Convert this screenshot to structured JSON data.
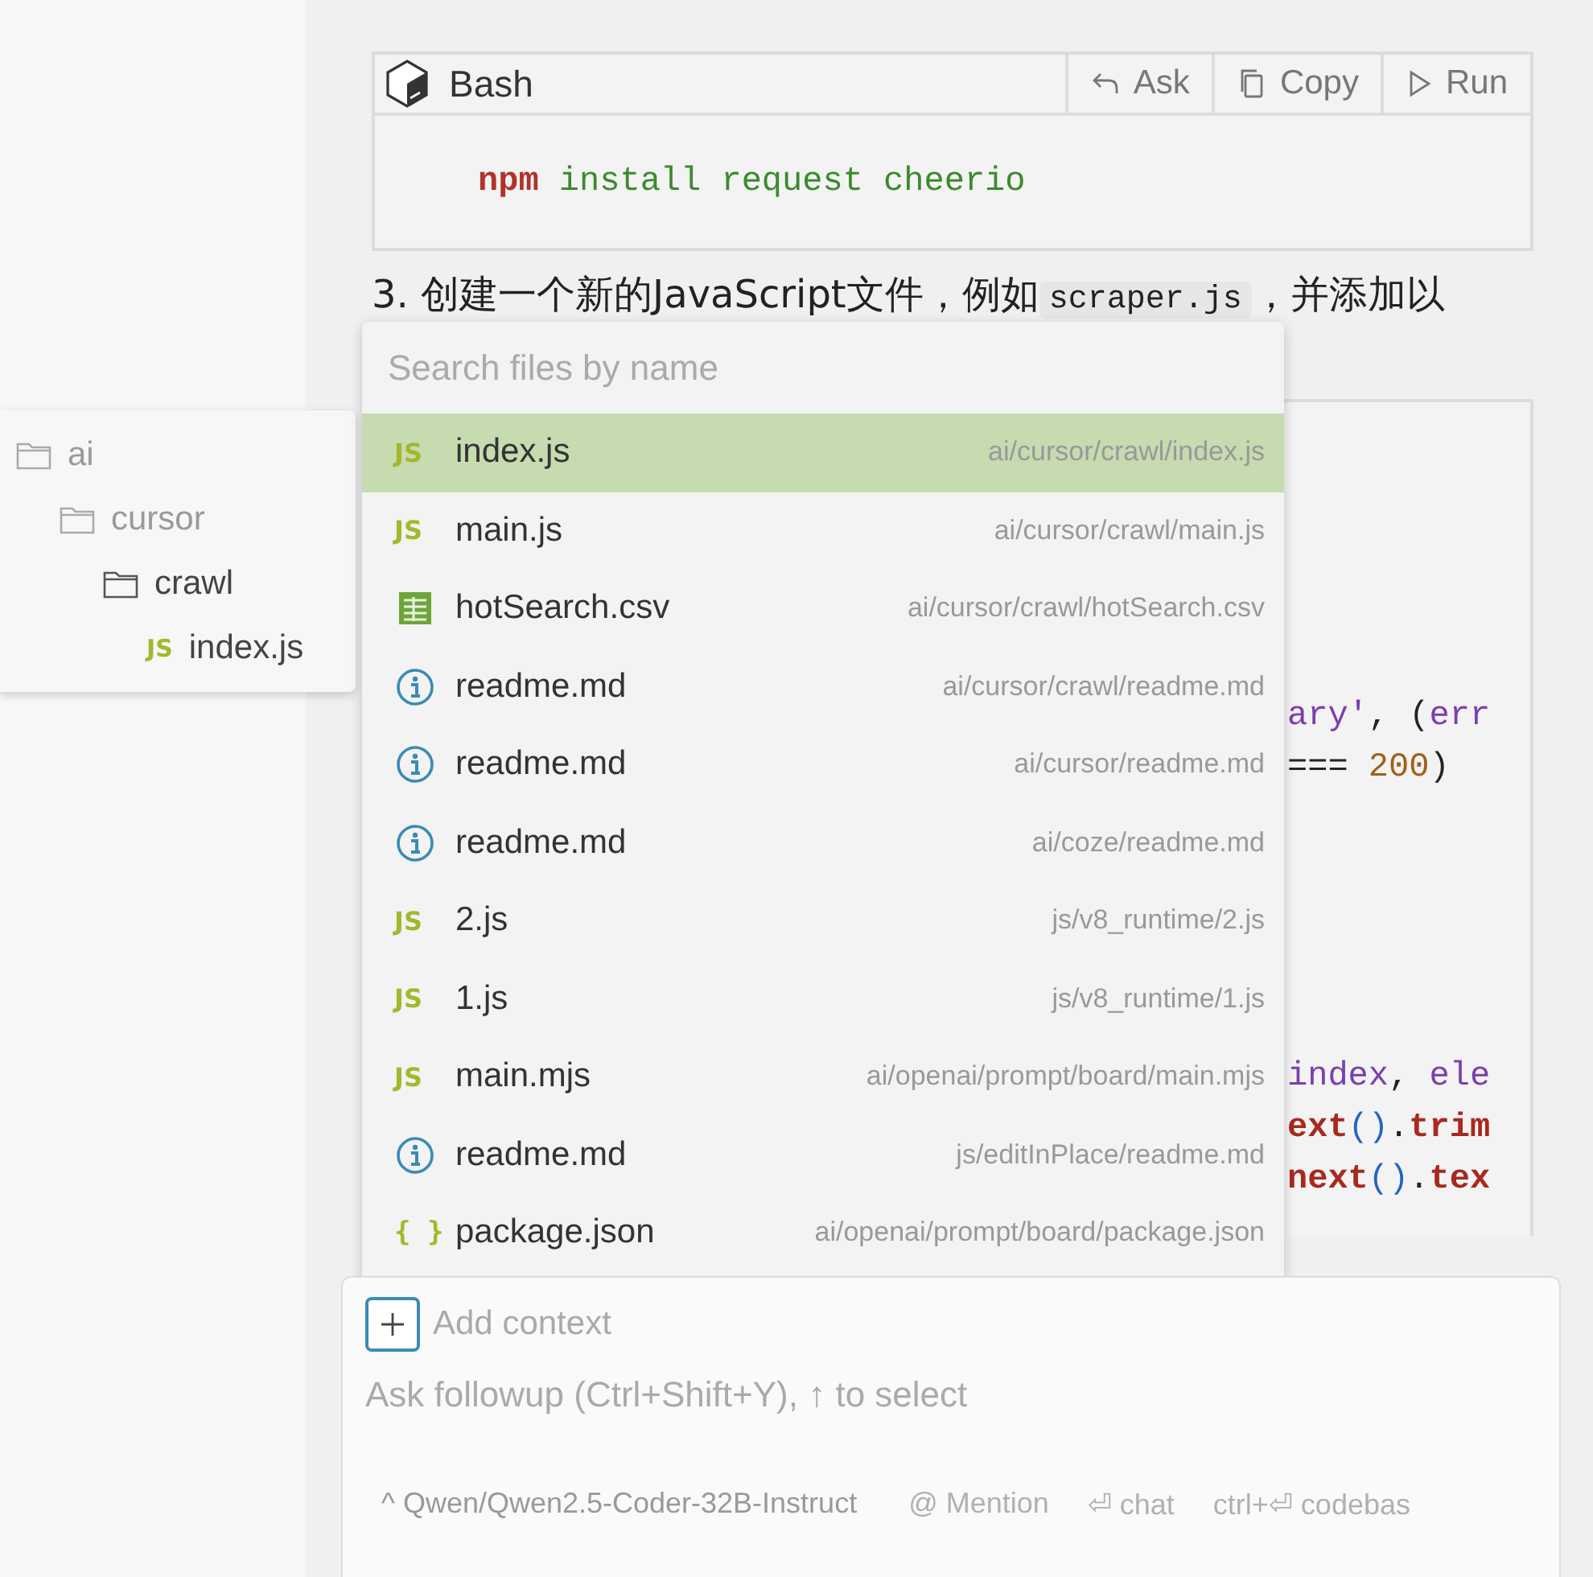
{
  "code_block": {
    "language": "Bash",
    "actions": [
      {
        "kind": "ask",
        "label": "Ask"
      },
      {
        "kind": "copy",
        "label": "Copy"
      },
      {
        "kind": "run",
        "label": "Run"
      }
    ],
    "code": [
      {
        "kind": "cmd",
        "text": "npm"
      },
      {
        "kind": "arg",
        "text": " install request cheerio"
      }
    ]
  },
  "paragraph": {
    "before": "3. 创建一个新的JavaScript文件，例如",
    "code": "scraper.js",
    "after": "，并添加以"
  },
  "code_fragments": [
    [
      [
        {
          "kind": "var",
          "text": "ary'"
        },
        {
          "kind": "plain",
          "text": ", ("
        },
        {
          "kind": "var",
          "text": "err"
        }
      ],
      [
        {
          "kind": "plain",
          "text": "=== "
        },
        {
          "kind": "num",
          "text": "200"
        },
        {
          "kind": "plain",
          "text": ")"
        }
      ]
    ],
    [
      [
        {
          "kind": "var",
          "text": "index"
        },
        {
          "kind": "plain",
          "text": ", "
        },
        {
          "kind": "var",
          "text": "ele"
        }
      ],
      [
        {
          "kind": "fn",
          "text": "ext"
        },
        {
          "kind": "paren",
          "text": "()"
        },
        {
          "kind": "plain",
          "text": "."
        },
        {
          "kind": "fn",
          "text": "trim"
        }
      ],
      [
        {
          "kind": "fn",
          "text": "next"
        },
        {
          "kind": "paren",
          "text": "()"
        },
        {
          "kind": "plain",
          "text": "."
        },
        {
          "kind": "fn",
          "text": "tex"
        }
      ]
    ]
  ],
  "tree": [
    {
      "name": "ai",
      "kind": "folder",
      "dimmed": true,
      "children": [
        {
          "name": "cursor",
          "kind": "folder",
          "dimmed": true,
          "children": [
            {
              "name": "crawl",
              "kind": "folder",
              "dimmed": false,
              "children": [
                {
                  "name": "index.js",
                  "kind": "js",
                  "badge": "JS",
                  "dimmed": false
                }
              ]
            }
          ]
        }
      ]
    }
  ],
  "file_picker": {
    "placeholder": "Search files by name",
    "items": [
      {
        "kind": "js",
        "badge": "JS",
        "name": "index.js",
        "path": "ai/cursor/crawl/index.js",
        "selected": true
      },
      {
        "kind": "js",
        "badge": "JS",
        "name": "main.js",
        "path": "ai/cursor/crawl/main.js",
        "selected": false
      },
      {
        "kind": "csv",
        "name": "hotSearch.csv",
        "path": "ai/cursor/crawl/hotSearch.csv",
        "selected": false
      },
      {
        "kind": "info",
        "name": "readme.md",
        "path": "ai/cursor/crawl/readme.md",
        "selected": false
      },
      {
        "kind": "info",
        "name": "readme.md",
        "path": "ai/cursor/readme.md",
        "selected": false
      },
      {
        "kind": "info",
        "name": "readme.md",
        "path": "ai/coze/readme.md",
        "selected": false
      },
      {
        "kind": "js",
        "badge": "JS",
        "name": "2.js",
        "path": "js/v8_runtime/2.js",
        "selected": false
      },
      {
        "kind": "js",
        "badge": "JS",
        "name": "1.js",
        "path": "js/v8_runtime/1.js",
        "selected": false
      },
      {
        "kind": "js",
        "badge": "JS",
        "name": "main.mjs",
        "path": "ai/openai/prompt/board/main.mjs",
        "selected": false
      },
      {
        "kind": "info",
        "name": "readme.md",
        "path": "js/editInPlace/readme.md",
        "selected": false
      },
      {
        "kind": "json",
        "badge": "{ }",
        "name": "package.json",
        "path": "ai/openai/prompt/board/package.json",
        "selected": false
      }
    ]
  },
  "chat_input": {
    "add_context": "Add context",
    "placeholder": "Ask followup (Ctrl+Shift+Y), ↑ to select",
    "footer": [
      {
        "kind": "model",
        "text": "^ Qwen/Qwen2.5-Coder-32B-Instruct"
      },
      {
        "kind": "hint",
        "text": "@ Mention"
      },
      {
        "kind": "hint",
        "text": "⏎ chat"
      },
      {
        "kind": "hint",
        "text": "ctrl+⏎ codebas"
      }
    ]
  }
}
